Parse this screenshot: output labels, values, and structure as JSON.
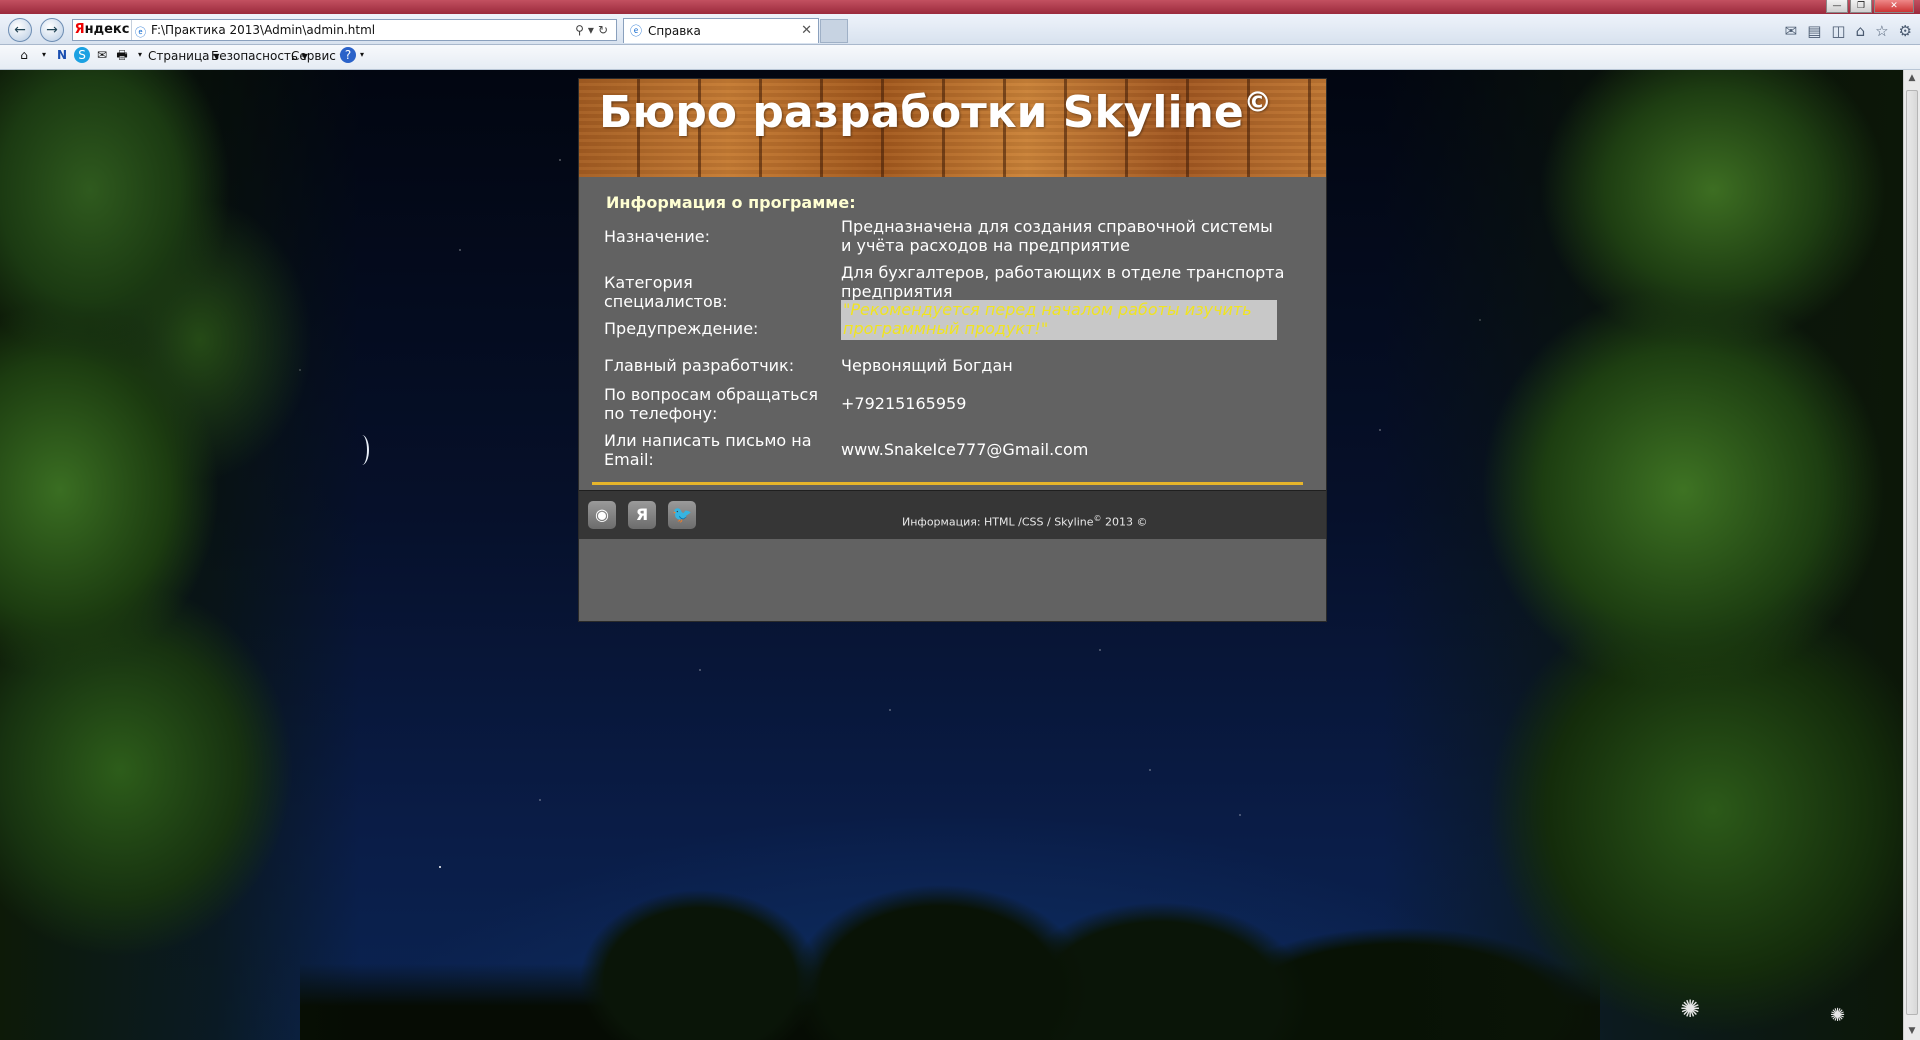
{
  "browser": {
    "address": {
      "search_label_y": "Я",
      "search_label_rest": "ндекс",
      "url": "F:\\Практика 2013\\Admin\\admin.html"
    },
    "tab": {
      "title": "Справка"
    },
    "toolbar": {
      "page_label": "Страница ▾",
      "security_label": "Безопасность ▾",
      "service_label": "Сервис ▾"
    }
  },
  "page": {
    "header": {
      "title": "Бюро разработки Skyline",
      "title_mark": "©"
    },
    "section_title": "Информация о программе:",
    "rows": [
      {
        "label": "Назначение:",
        "value": "Предназначена для создания справочной системы и учёта расходов на предприятие"
      },
      {
        "label": "Категория специалистов:",
        "value": "Для бухгалтеров, работающих в отделе транспорта предприятия"
      },
      {
        "label": "Предупреждение:",
        "value": "\"Рекомендуется перед началом работы изучить программный продукт!\""
      },
      {
        "label": "Главный разработчик:",
        "value": "Червонящий Богдан"
      },
      {
        "label": "По вопросам обращаться по телефону:",
        "value": "+79215165959"
      },
      {
        "label": "Или написать письмо на Email:",
        "value": "www.SnakeIce777@Gmail.com"
      }
    ],
    "footer": {
      "social": [
        {
          "icon": "rss-icon",
          "glyph": "◉"
        },
        {
          "icon": "yandex-icon",
          "glyph": "Я"
        },
        {
          "icon": "twitter-icon",
          "glyph": "🐦"
        }
      ],
      "text_before": "Информация: HTML /CSS / Skyline",
      "text_mark": "©",
      "text_after": " 2013 ©"
    }
  },
  "colors": {
    "accent_gold": "#e6b52b",
    "section_title": "#ffffd2",
    "warning_text": "#f0e422",
    "card_bg": "#626262"
  }
}
